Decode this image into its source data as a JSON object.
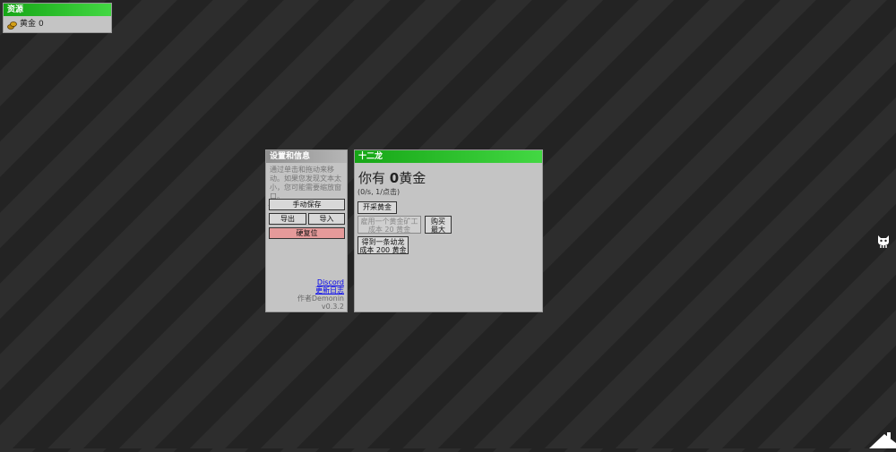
{
  "resources": {
    "title": "资源",
    "gold_label": "黄金",
    "gold_value": "0",
    "icon": "gold-coins-icon"
  },
  "settings": {
    "title": "设置和信息",
    "info_text": "通过单击和拖动来移动。如果您发现文本太小，您可能需要缩放窗口。",
    "save_label": "手动保存",
    "export_label": "导出",
    "import_label": "导入",
    "reset_label": "硬复位",
    "discord_label": "Discord",
    "changelog_label": "更新日志",
    "author_label": "作者Demonin",
    "version_label": "v0.3.2"
  },
  "dragon_panel": {
    "title": "十二龙",
    "gold_prefix": "你有",
    "gold_value": "0",
    "gold_suffix": "黄金",
    "rate_text": "(0/s, 1/点击)",
    "mine_button": "开采黄金",
    "hire_button_line1": "雇用一个黄金矿工",
    "hire_button_line2": "成本 20 黄金",
    "buy_max_line1": "购买",
    "buy_max_line2": "最大",
    "dragon_button_line1": "得到一条幼龙",
    "dragon_button_line2": "成本 200 黄金"
  },
  "colors": {
    "header_green": "#2cc22c",
    "panel_gray": "#c4c4c4",
    "reset_red": "#e59a9a",
    "background": "#262626"
  },
  "icons": [
    "gold-coins-icon",
    "github-cat-icon",
    "home-icon"
  ]
}
